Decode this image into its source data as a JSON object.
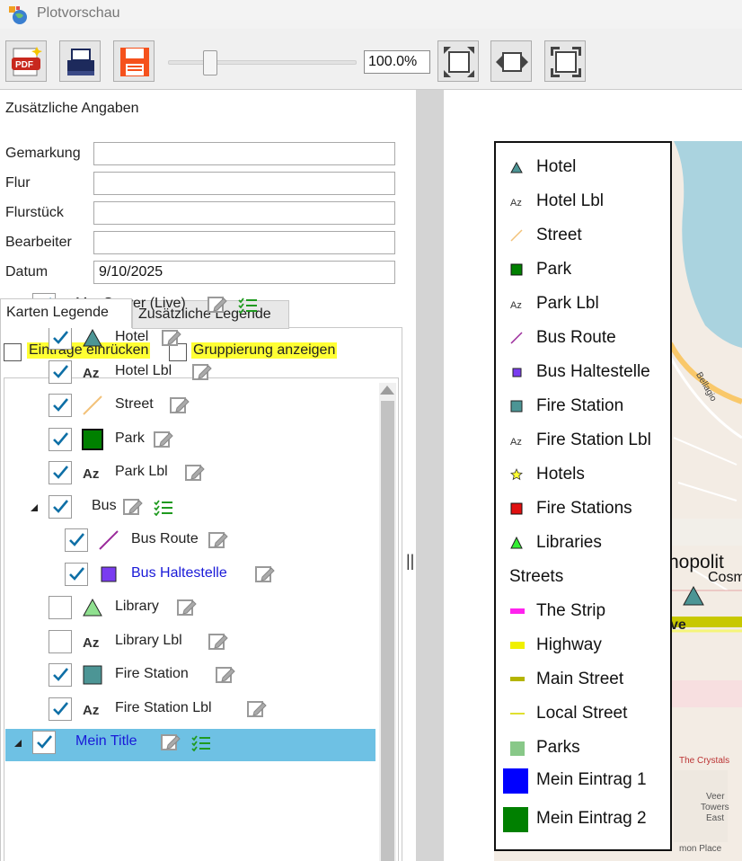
{
  "window": {
    "title": "Plotvorschau"
  },
  "toolbar": {
    "buttons": [
      "pdf-export-icon",
      "print-icon",
      "save-icon",
      "fit-page-icon",
      "fit-width-icon",
      "fit-all-icon"
    ],
    "zoom_value": "100.0%",
    "zoom_slider_fraction": 0.2
  },
  "info": {
    "title": "Zusätzliche Angaben",
    "fields": [
      {
        "label": "Gemarkung",
        "value": ""
      },
      {
        "label": "Flur",
        "value": ""
      },
      {
        "label": "Flurstück",
        "value": ""
      },
      {
        "label": "Bearbeiter",
        "value": ""
      },
      {
        "label": "Datum",
        "value": "9/10/2025"
      }
    ]
  },
  "tabs": [
    {
      "label": "Karten Legende",
      "active": true
    },
    {
      "label": "Zusätzliche Legende",
      "active": false
    }
  ],
  "options": {
    "indent_label": "Einträge einrücken",
    "grouping_label": "Gruppierung anzeigen"
  },
  "tree": {
    "items": [
      {
        "label": "MapServer (Live)",
        "checked": true,
        "symbol": "group"
      },
      {
        "label": "Hotel",
        "checked": true,
        "symbol": "triangle-teal"
      },
      {
        "label": "Hotel Lbl",
        "checked": true,
        "symbol": "az"
      },
      {
        "label": "Street",
        "checked": true,
        "symbol": "line-tan"
      },
      {
        "label": "Park",
        "checked": true,
        "symbol": "square-green"
      },
      {
        "label": "Park Lbl",
        "checked": true,
        "symbol": "az"
      },
      {
        "label": "Bus",
        "checked": true,
        "symbol": "group"
      },
      {
        "label": "Bus Route",
        "checked": true,
        "symbol": "line-purple"
      },
      {
        "label": "Bus Haltestelle",
        "checked": true,
        "symbol": "square-purple"
      },
      {
        "label": "Library",
        "checked": false,
        "symbol": "triangle-lightgreen"
      },
      {
        "label": "Library Lbl",
        "checked": false,
        "symbol": "az"
      },
      {
        "label": "Fire Station",
        "checked": true,
        "symbol": "square-teal"
      },
      {
        "label": "Fire Station Lbl",
        "checked": true,
        "symbol": "az"
      },
      {
        "label": "Mein Title",
        "checked": true,
        "symbol": "group"
      }
    ]
  },
  "legend": {
    "items": [
      {
        "label": "Hotel",
        "symbol": "triangle-teal"
      },
      {
        "label": "Hotel Lbl",
        "symbol": "az"
      },
      {
        "label": "Street",
        "symbol": "line-tan"
      },
      {
        "label": "Park",
        "symbol": "square-green"
      },
      {
        "label": "Park Lbl",
        "symbol": "az"
      },
      {
        "label": "Bus Route",
        "symbol": "line-purple"
      },
      {
        "label": "Bus Haltestelle",
        "symbol": "square-purple"
      },
      {
        "label": "Fire Station",
        "symbol": "square-teal"
      },
      {
        "label": "Fire Station Lbl",
        "symbol": "az"
      },
      {
        "label": "Hotels",
        "symbol": "star-yellow"
      },
      {
        "label": "Fire Stations",
        "symbol": "square-red"
      },
      {
        "label": "Libraries",
        "symbol": "triangle-green"
      },
      {
        "label": "Streets",
        "symbol": "none"
      },
      {
        "label": "The Strip",
        "symbol": "bar-magenta"
      },
      {
        "label": "Highway",
        "symbol": "bar-yellow"
      },
      {
        "label": "Main Street",
        "symbol": "bar-olive"
      },
      {
        "label": "Local Street",
        "symbol": "line-yellow"
      },
      {
        "label": "Parks",
        "symbol": "square-lightgreen"
      },
      {
        "label": "Mein Eintrag 1",
        "symbol": "big-blue"
      },
      {
        "label": "Mein Eintrag 2",
        "symbol": "big-green"
      }
    ]
  },
  "map": {
    "labels": {
      "place": "nopolit",
      "place2": "Cosm",
      "street": "ve",
      "crystals": "The Crystals",
      "veer": "Veer",
      "towers": "Towers",
      "east": "East",
      "bellagio": "Bellagio",
      "mon_place": "mon Place"
    }
  },
  "colors": {
    "accent_selected": "#6ec1e4",
    "highlight": "#ffff33",
    "check": "#0e6fa6"
  }
}
